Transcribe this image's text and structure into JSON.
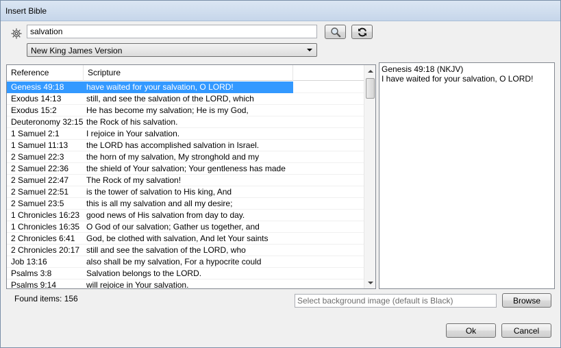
{
  "window": {
    "title": "Insert Bible"
  },
  "search": {
    "value": "salvation"
  },
  "version": {
    "selected": "New King James Version"
  },
  "grid": {
    "columns": [
      "Reference",
      "Scripture"
    ],
    "rows": [
      {
        "ref": "Genesis 49:18",
        "text": "have waited for your salvation, O LORD!"
      },
      {
        "ref": "Exodus 14:13",
        "text": "still, and see the salvation of the LORD, which"
      },
      {
        "ref": "Exodus 15:2",
        "text": "He has become my salvation; He is my God,"
      },
      {
        "ref": "Deuteronomy 32:15",
        "text": "the Rock of his salvation."
      },
      {
        "ref": "1 Samuel 2:1",
        "text": "I rejoice in Your salvation."
      },
      {
        "ref": "1 Samuel 11:13",
        "text": "the LORD has accomplished salvation in Israel."
      },
      {
        "ref": "2 Samuel 22:3",
        "text": "the horn of my salvation, My stronghold and my"
      },
      {
        "ref": "2 Samuel 22:36",
        "text": "the shield of Your salvation; Your gentleness has made"
      },
      {
        "ref": "2 Samuel 22:47",
        "text": "The Rock of my salvation!"
      },
      {
        "ref": "2 Samuel 22:51",
        "text": "is the tower of salvation to His king, And"
      },
      {
        "ref": "2 Samuel 23:5",
        "text": "this is all my salvation and all my desire;"
      },
      {
        "ref": "1 Chronicles 16:23",
        "text": "good news of His salvation from day to day."
      },
      {
        "ref": "1 Chronicles 16:35",
        "text": "O God of our salvation; Gather us together, and"
      },
      {
        "ref": "2 Chronicles 6:41",
        "text": "God, be clothed with salvation, And let Your saints"
      },
      {
        "ref": "2 Chronicles 20:17",
        "text": "still and see the salvation of the LORD, who"
      },
      {
        "ref": "Job 13:16",
        "text": "also shall be my salvation, For a hypocrite could"
      },
      {
        "ref": "Psalms 3:8",
        "text": "Salvation belongs to the LORD."
      },
      {
        "ref": "Psalms 9:14",
        "text": "will rejoice in Your salvation."
      }
    ]
  },
  "preview": {
    "reference": "Genesis 49:18 (NKJV)",
    "text": "I have waited for your salvation, O LORD!"
  },
  "status": {
    "found": "Found items: 156"
  },
  "background": {
    "placeholder": "Select background image (default is Black)"
  },
  "buttons": {
    "browse": "Browse",
    "ok": "Ok",
    "cancel": "Cancel"
  },
  "icons": {
    "settings": "gear-icon",
    "search": "magnifier-icon",
    "refresh": "refresh-icon"
  },
  "colors": {
    "selection": "#3399ff",
    "titlebar": "#c6d6ea"
  }
}
